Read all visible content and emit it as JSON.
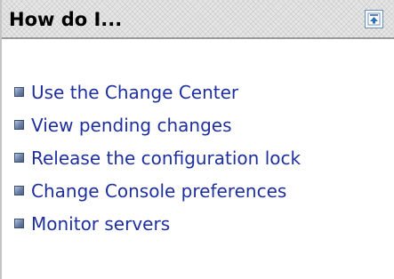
{
  "panel": {
    "title": "How do I...",
    "collapse_icon": "collapse-up-icon"
  },
  "links": [
    {
      "label": "Use the Change Center",
      "icon": "bullet-square-icon"
    },
    {
      "label": "View pending changes",
      "icon": "bullet-square-icon"
    },
    {
      "label": "Release the configuration lock",
      "icon": "bullet-square-icon"
    },
    {
      "label": "Change Console preferences",
      "icon": "bullet-square-icon"
    },
    {
      "label": "Monitor servers",
      "icon": "bullet-square-icon"
    }
  ],
  "colors": {
    "link": "#1e2f9e",
    "header_bg": "#e6e6e6",
    "header_border": "#9a9a9a",
    "bullet": "#5c7099"
  }
}
